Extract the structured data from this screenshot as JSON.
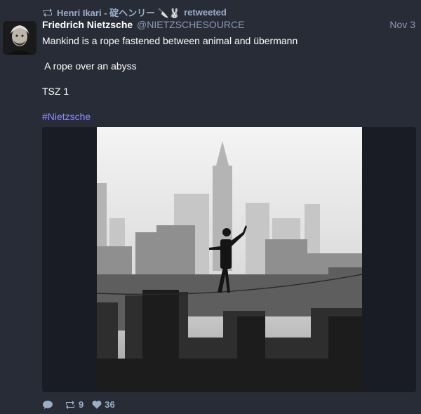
{
  "reblog": {
    "user_name": "Henri Ikari - 碇ヘンリー 🔪🐰",
    "action_text": "retweeted"
  },
  "status": {
    "display_name": "Friedrich Nietzsche",
    "handle": "@NIETZSCHESOURCE",
    "time": "Nov 3",
    "lines": [
      "Mankind is a rope fastened between animal and übermann",
      " A rope over an abyss",
      "TSZ 1"
    ],
    "hashtag": "#Nietzsche",
    "media_alt": "Tightrope walker above a city skyline"
  },
  "actions": {
    "reply_count": "",
    "boost_count": "9",
    "favourite_count": "36"
  },
  "colors": {
    "background": "#282c37",
    "muted": "#9baec8",
    "hashtag": "#8c8dff"
  }
}
